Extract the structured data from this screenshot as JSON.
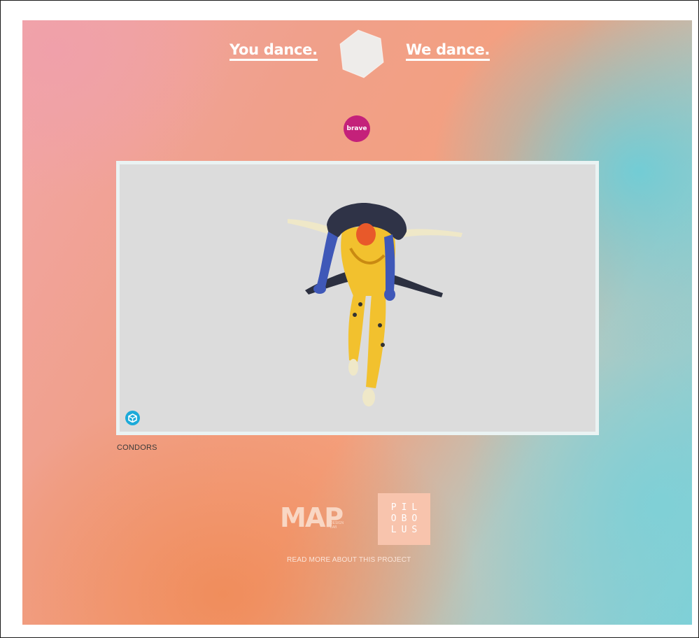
{
  "nav": {
    "left_link": "You dance.",
    "right_link": "We dance.",
    "logo_icon": "hexagon-icon"
  },
  "tag": {
    "label": "brave",
    "color": "#c4217a"
  },
  "viewer": {
    "model_icon": "sketchfab-cube-icon",
    "background": "#dcdcdc"
  },
  "caption": "CONDORS",
  "footer": {
    "map_logo": "MAP",
    "map_logo_sub": [
      "DESIGN",
      "LAB"
    ],
    "pilobolus_logo": [
      "PIL",
      "OBO",
      "LUS"
    ],
    "read_more": "READ MORE ABOUT THIS PROJECT"
  },
  "colors": {
    "gradient_pink": "#f2a6a8",
    "gradient_orange": "#f08c5a",
    "gradient_teal": "#7fd0d8",
    "sketchfab_blue": "#1caad9"
  }
}
